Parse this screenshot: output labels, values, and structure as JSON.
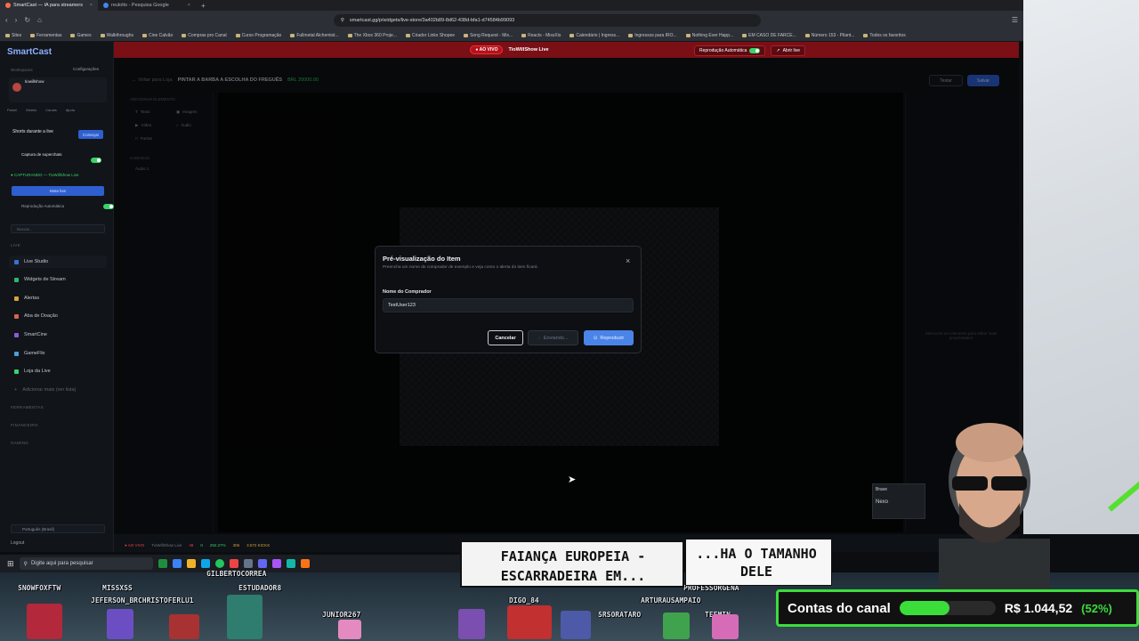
{
  "browser": {
    "tabs": [
      {
        "label": "SmartCast — IA para streamers",
        "active": true
      },
      {
        "label": "reulolto - Pesquisa Google",
        "active": false
      }
    ],
    "url": "smartcast.gg/p/widgets/live-store/3a402b89-8d62-438d-bfa1-d74584b99093",
    "bookmarks": [
      "Sites",
      "Ferramentas",
      "Games",
      "Walkthroughs",
      "Cine Calvão",
      "Compras pro Canal",
      "Curso Programação",
      "Fullmetal Alchemist...",
      "The Xbox 360 Proje...",
      "Criador Links Shopee",
      "Song Request - Mix...",
      "Reacts - MissXis",
      "Calendário | Ingress...",
      "Ingressos para IRO...",
      "Nothing Ever Happ...",
      "EM CASO DE FARCE...",
      "Número 153 - Pilant...",
      "Todos os favoritos"
    ]
  },
  "livebar": {
    "badge": "● AO VIVO",
    "channel": "TioWillShow Live",
    "autoplay": "Reprodução Automática",
    "open_live": "Abrir live"
  },
  "sidebar": {
    "brand": "SmartCast",
    "workspaces": "Workspaces",
    "config": "Configurações",
    "user": "tiowillshow",
    "shorts": "Shorts durante a live",
    "shorts_btn": "Começar",
    "capture": "Captura de superchats",
    "capturing": "● CAPTURANDO — TioWillShow Live",
    "mute": "Mute live",
    "autoplay": "Reprodução Automática",
    "search": "Buscar...",
    "section_live": "LIVE",
    "items": [
      "Live Studio",
      "Widgets de Stream",
      "Alertas",
      "Aba de Doação",
      "SmartCine",
      "GameFlix",
      "Loja da Live",
      "Adicionar mais (ver lista)"
    ],
    "sections": [
      "FERRAMENTAS",
      "FINANCEIRO",
      "GAMING"
    ],
    "language": "Português (Brasil)",
    "logout": "Logout"
  },
  "editor": {
    "back": "← Voltar para Loja",
    "title": "PINTAR A BARBA A ESCOLHA DO FREGUÊS",
    "price": "BRL 20000.00",
    "test": "Testar",
    "save": "Salvar",
    "add_element": "ADICIONAR ELEMENTO",
    "elements": [
      "Texto",
      "Imagem",
      "Vídeo",
      "Áudio",
      "Forma"
    ],
    "layers": "CAMADAS",
    "layer_items": [
      "Áudio 1"
    ],
    "right_hint": "Selecione um elemento para editar suas propriedades"
  },
  "modal": {
    "title": "Pré-visualização do Item",
    "description": "Preencha um nome de comprador de exemplo e veja como o alerta do item ficará.",
    "field_label": "Nome do Comprador",
    "field_value": "TestUser123",
    "cancel": "Cancelar",
    "sending": "Enviando...",
    "play": "Reproduzir"
  },
  "statusbar": {
    "live": "● AO VIVO",
    "channel": "TioWillShow Live",
    "viewers": "48",
    "stat2": "0",
    "time": "292.27%",
    "stat4": "306",
    "kicks": "3.572 KICKS"
  },
  "taskbar": {
    "search": "Digite aqui para pesquisar"
  },
  "stream": {
    "ticker": "FAIANÇA EUROPEIA - ESCARRADEIRA EM...",
    "ticker2": "...HA O TAMANHO DELE",
    "brave_title": "Brave",
    "brave_text": "Nexo",
    "nicks": [
      "SNOWFOXFTW",
      "MISSXSS",
      "GILBERTOCORREA",
      "JEFERSON_BRCHRISTOFERLU1",
      "ESTUDADOR8",
      "DIGO_84",
      "JUNIOR267",
      "ARTURAUSAMPAIO",
      "PROFESSORGENA",
      "SRSORATARO",
      "TEEMIN"
    ],
    "goal_label": "Contas do canal",
    "goal_amount": "R$ 1.044,52",
    "goal_percent_text": "(52%)",
    "goal_fraction": 0.52
  }
}
